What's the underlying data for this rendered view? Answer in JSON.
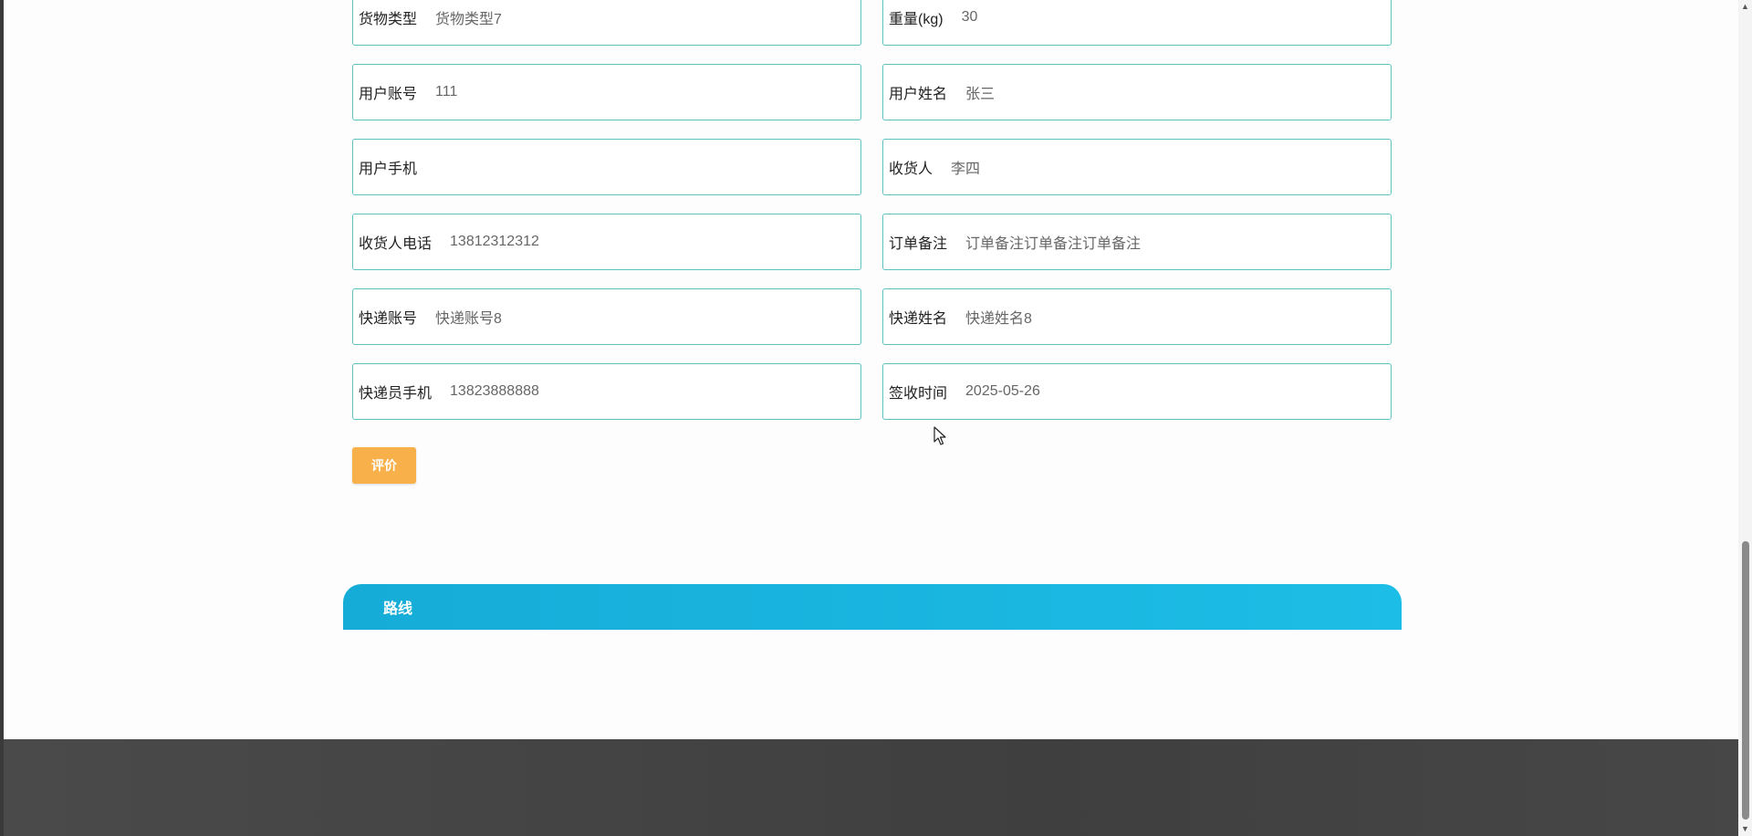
{
  "form": {
    "fields": [
      {
        "label": "货物类型",
        "value": "货物类型7"
      },
      {
        "label": "重量(kg)",
        "value": "30"
      },
      {
        "label": "用户账号",
        "value": "111"
      },
      {
        "label": "用户姓名",
        "value": "张三"
      },
      {
        "label": "用户手机",
        "value": ""
      },
      {
        "label": "收货人",
        "value": "李四"
      },
      {
        "label": "收货人电话",
        "value": "13812312312"
      },
      {
        "label": "订单备注",
        "value": "订单备注订单备注订单备注"
      },
      {
        "label": "快递账号",
        "value": "快递账号8"
      },
      {
        "label": "快递姓名",
        "value": "快递姓名8"
      },
      {
        "label": "快递员手机",
        "value": "13823888888"
      },
      {
        "label": "签收时间",
        "value": "2025-05-26"
      }
    ]
  },
  "actions": {
    "rate_label": "评价"
  },
  "route": {
    "title": "路线"
  },
  "icons": {
    "cursor": "mouse-pointer-icon",
    "scroll_up": "scroll-up-arrow-icon",
    "scroll_down": "scroll-down-arrow-icon"
  },
  "colors": {
    "field_border": "#5ec3c0",
    "button_bg": "#f8b04a",
    "route_bar": "#16acd8",
    "footer_bg": "#444444"
  }
}
